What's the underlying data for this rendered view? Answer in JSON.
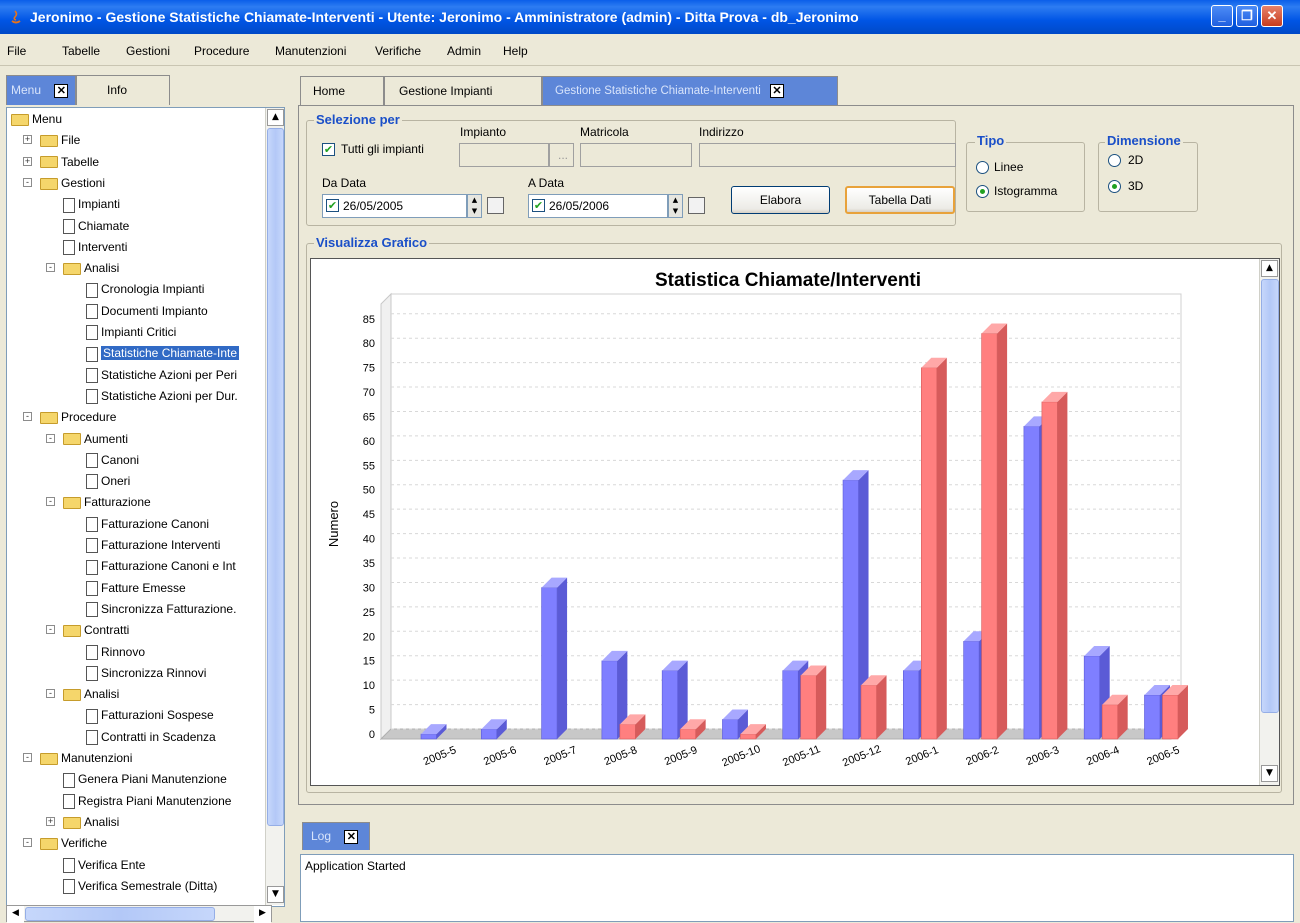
{
  "window": {
    "title": "Jeronimo - Gestione Statistiche Chiamate-Interventi - Utente:  Jeronimo - Amministratore (admin) - Ditta Prova - db_Jeronimo",
    "min_icon": "minimize-icon",
    "max_icon": "maximize-icon",
    "close_icon": "close-icon"
  },
  "menubar": [
    "File",
    "Tabelle",
    "Gestioni",
    "Procedure",
    "Manutenzioni",
    "Verifiche",
    "Admin",
    "Help"
  ],
  "left_tabs": {
    "menu": "Menu",
    "info": "Info"
  },
  "tree": [
    {
      "label": "Menu",
      "type": "folder",
      "level": 0
    },
    {
      "label": "File",
      "type": "folder",
      "level": 1,
      "exp": "+"
    },
    {
      "label": "Tabelle",
      "type": "folder",
      "level": 1,
      "exp": "+"
    },
    {
      "label": "Gestioni",
      "type": "folder",
      "level": 1,
      "exp": "-"
    },
    {
      "label": "Impianti",
      "type": "doc",
      "level": 2
    },
    {
      "label": "Chiamate",
      "type": "doc",
      "level": 2
    },
    {
      "label": "Interventi",
      "type": "doc",
      "level": 2
    },
    {
      "label": "Analisi",
      "type": "folder",
      "level": 2,
      "exp": "-"
    },
    {
      "label": "Cronologia Impianti",
      "type": "doc",
      "level": 3
    },
    {
      "label": "Documenti Impianto",
      "type": "doc",
      "level": 3
    },
    {
      "label": "Impianti Critici",
      "type": "doc",
      "level": 3
    },
    {
      "label": "Statistiche Chiamate-Inte",
      "type": "doc",
      "level": 3,
      "selected": true
    },
    {
      "label": "Statistiche Azioni per Peri",
      "type": "doc",
      "level": 3
    },
    {
      "label": "Statistiche Azioni per Dur.",
      "type": "doc",
      "level": 3
    },
    {
      "label": "Procedure",
      "type": "folder",
      "level": 1,
      "exp": "-"
    },
    {
      "label": "Aumenti",
      "type": "folder",
      "level": 2,
      "exp": "-"
    },
    {
      "label": "Canoni",
      "type": "doc",
      "level": 3
    },
    {
      "label": "Oneri",
      "type": "doc",
      "level": 3
    },
    {
      "label": "Fatturazione",
      "type": "folder",
      "level": 2,
      "exp": "-"
    },
    {
      "label": "Fatturazione Canoni",
      "type": "doc",
      "level": 3
    },
    {
      "label": "Fatturazione Interventi",
      "type": "doc",
      "level": 3
    },
    {
      "label": "Fatturazione Canoni e Int",
      "type": "doc",
      "level": 3
    },
    {
      "label": "Fatture Emesse",
      "type": "doc",
      "level": 3
    },
    {
      "label": "Sincronizza Fatturazione.",
      "type": "doc",
      "level": 3
    },
    {
      "label": "Contratti",
      "type": "folder",
      "level": 2,
      "exp": "-"
    },
    {
      "label": "Rinnovo",
      "type": "doc",
      "level": 3
    },
    {
      "label": "Sincronizza Rinnovi",
      "type": "doc",
      "level": 3
    },
    {
      "label": "Analisi",
      "type": "folder",
      "level": 2,
      "exp": "-"
    },
    {
      "label": "Fatturazioni Sospese",
      "type": "doc",
      "level": 3
    },
    {
      "label": "Contratti in Scadenza",
      "type": "doc",
      "level": 3
    },
    {
      "label": "Manutenzioni",
      "type": "folder",
      "level": 1,
      "exp": "-"
    },
    {
      "label": "Genera Piani Manutenzione",
      "type": "doc",
      "level": 2
    },
    {
      "label": "Registra Piani Manutenzione",
      "type": "doc",
      "level": 2
    },
    {
      "label": "Analisi",
      "type": "folder",
      "level": 2,
      "exp": "+"
    },
    {
      "label": "Verifiche",
      "type": "folder",
      "level": 1,
      "exp": "-"
    },
    {
      "label": "Verifica Ente",
      "type": "doc",
      "level": 2
    },
    {
      "label": "Verifica Semestrale (Ditta)",
      "type": "doc",
      "level": 2
    }
  ],
  "main_tabs": [
    {
      "label": "Home"
    },
    {
      "label": "Gestione Impianti"
    },
    {
      "label": "Gestione Statistiche Chiamate-Interventi",
      "active": true
    }
  ],
  "selection": {
    "legend": "Selezione per",
    "all_plants_label": "Tutti gli impianti",
    "all_plants_checked": true,
    "impianto_label": "Impianto",
    "impianto_value": "",
    "browse_label": "...",
    "matricola_label": "Matricola",
    "matricola_value": "",
    "indirizzo_label": "Indirizzo",
    "indirizzo_value": "",
    "da_data_label": "Da Data",
    "da_data_value": "26/05/2005",
    "a_data_label": "A Data",
    "a_data_value": "26/05/2006",
    "elabora_label": "Elabora",
    "tabella_label": "Tabella Dati"
  },
  "tipo": {
    "legend": "Tipo",
    "options": [
      "Linee",
      "Istogramma"
    ],
    "selected": "Istogramma"
  },
  "dimensione": {
    "legend": "Dimensione",
    "options": [
      "2D",
      "3D"
    ],
    "selected": "3D"
  },
  "graph_legend": "Visualizza Grafico",
  "log": {
    "tab": "Log",
    "text": "Application Started"
  },
  "colors": {
    "series_blue": "#7f7fff",
    "series_red": "#ff7f7f",
    "accent": "#316ac5"
  },
  "chart_data": {
    "type": "bar",
    "title": "Statistica Chiamate/Interventi",
    "xlabel": "",
    "ylabel": "Numero",
    "ylim": [
      0,
      87
    ],
    "yticks": [
      0,
      5,
      10,
      15,
      20,
      25,
      30,
      35,
      40,
      45,
      50,
      55,
      60,
      65,
      70,
      75,
      80,
      85
    ],
    "categories": [
      "2005-5",
      "2005-6",
      "2005-7",
      "2005-8",
      "2005-9",
      "2005-10",
      "2005-11",
      "2005-12",
      "2006-1",
      "2006-2",
      "2006-3",
      "2006-4",
      "2006-5"
    ],
    "series": [
      {
        "values": [
          1,
          2,
          31,
          16,
          14,
          4,
          14,
          53,
          14,
          20,
          64,
          17,
          9
        ],
        "color": "#7f7fff"
      },
      {
        "values": [
          0,
          0,
          0,
          3,
          2,
          1,
          13,
          11,
          76,
          83,
          69,
          7,
          9
        ],
        "color": "#ff7f7f"
      }
    ],
    "render_3d": true,
    "grid": true
  }
}
